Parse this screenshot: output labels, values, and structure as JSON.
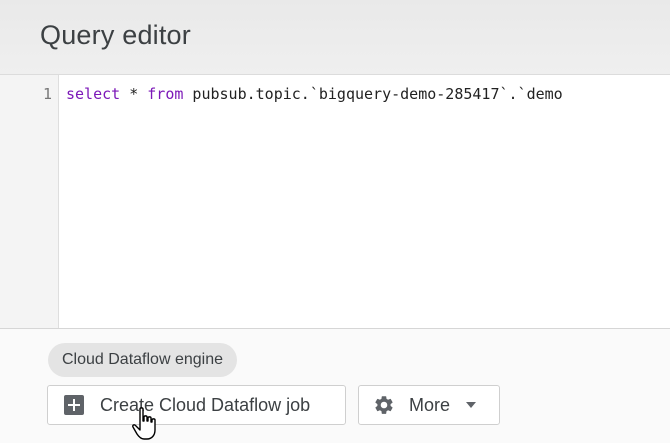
{
  "header": {
    "title": "Query editor"
  },
  "editor": {
    "line_number": "1",
    "code": {
      "kw_select": "select",
      "star": " * ",
      "kw_from": "from",
      "rest": " pubsub.topic.`bigquery-demo-285417`.`demo"
    }
  },
  "footer": {
    "engine_chip": "Cloud Dataflow engine",
    "create_button": "Create Cloud Dataflow job",
    "more_button": "More"
  },
  "icons": {
    "plus": "plus-box-icon",
    "gear": "gear-icon",
    "caret": "caret-down-icon",
    "cursor": "hand-pointer-cursor-icon"
  }
}
